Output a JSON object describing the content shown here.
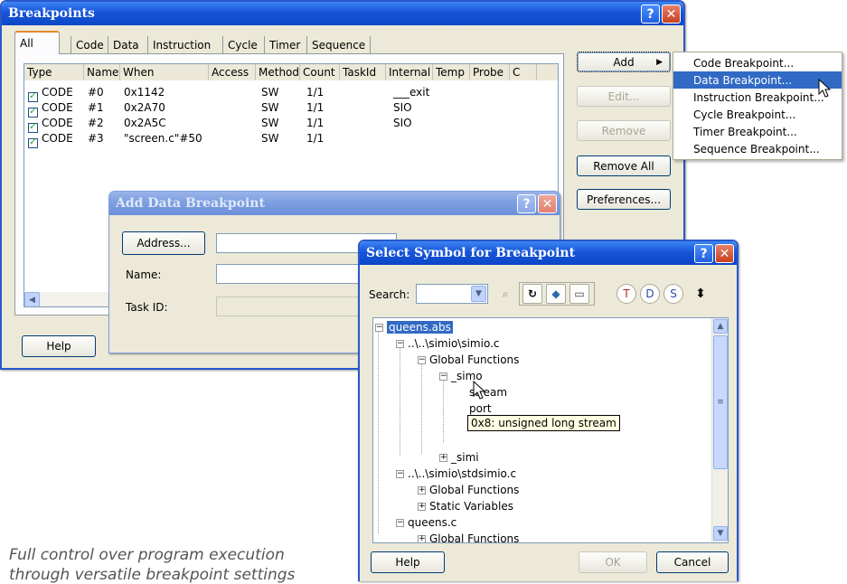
{
  "breakpoints_window": {
    "title": "Breakpoints",
    "tabs": [
      "All",
      "Code",
      "Data",
      "Instruction",
      "Cycle",
      "Timer",
      "Sequence"
    ],
    "columns": [
      "Type",
      "Name",
      "When",
      "Access",
      "Method",
      "Count",
      "TaskId",
      "Internal",
      "Temp",
      "Probe",
      "C"
    ],
    "rows": [
      {
        "type": "CODE",
        "name": "#0",
        "when": "0x1142",
        "method": "SW",
        "count": "1/1",
        "internal": "___exit"
      },
      {
        "type": "CODE",
        "name": "#1",
        "when": "0x2A70",
        "method": "SW",
        "count": "1/1",
        "internal": "SIO"
      },
      {
        "type": "CODE",
        "name": "#2",
        "when": "0x2A5C",
        "method": "SW",
        "count": "1/1",
        "internal": "SIO"
      },
      {
        "type": "CODE",
        "name": "#3",
        "when": "\"screen.c\"#50",
        "method": "SW",
        "count": "1/1",
        "internal": ""
      }
    ],
    "buttons": {
      "add": "Add",
      "edit": "Edit...",
      "remove": "Remove",
      "remove_all": "Remove All",
      "preferences": "Preferences...",
      "help": "Help"
    }
  },
  "add_menu": {
    "items": [
      "Code Breakpoint...",
      "Data Breakpoint...",
      "Instruction Breakpoint...",
      "Cycle Breakpoint...",
      "Timer Breakpoint...",
      "Sequence Breakpoint..."
    ],
    "selected": "Data Breakpoint..."
  },
  "add_data_dialog": {
    "title": "Add Data Breakpoint",
    "address_button": "Address...",
    "name_label": "Name:",
    "taskid_label": "Task ID:"
  },
  "symbol_dialog": {
    "title": "Select Symbol for Breakpoint",
    "search_label": "Search:",
    "tree": {
      "root": "queens.abs",
      "simio": "..\\..\\simio\\simio.c",
      "global_functions": "Global Functions",
      "simo": "_simo",
      "stream": "stream",
      "port": "port",
      "tooltip": "0x8: unsigned long  stream",
      "simi": "_simi",
      "stdsimio": "..\\..\\simio\\stdsimio.c",
      "global_functions_2": "Global Functions",
      "static_variables": "Static Variables",
      "queens_c": "queens.c",
      "global_functions_3": "Global Functions"
    },
    "buttons": {
      "help": "Help",
      "ok": "OK",
      "cancel": "Cancel"
    }
  },
  "caption": {
    "line1": "Full control over program execution",
    "line2": "through versatile breakpoint settings"
  },
  "colors": {
    "title_active": "#0a47c8",
    "selection": "#316ac5",
    "face": "#ece9d8"
  }
}
